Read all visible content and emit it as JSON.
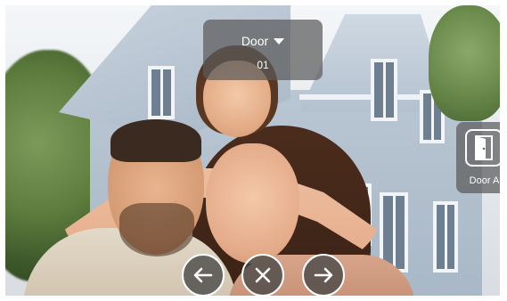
{
  "door_selector": {
    "title": "Door",
    "number": "01"
  },
  "door_panel": {
    "label": "Door A",
    "icon": "door-icon"
  },
  "controls": {
    "prev_icon": "arrow-left-icon",
    "close_icon": "close-icon",
    "next_icon": "arrow-right-icon"
  },
  "colors": {
    "overlay": "#5a5a5a",
    "icon_stroke": "#ffffff"
  }
}
